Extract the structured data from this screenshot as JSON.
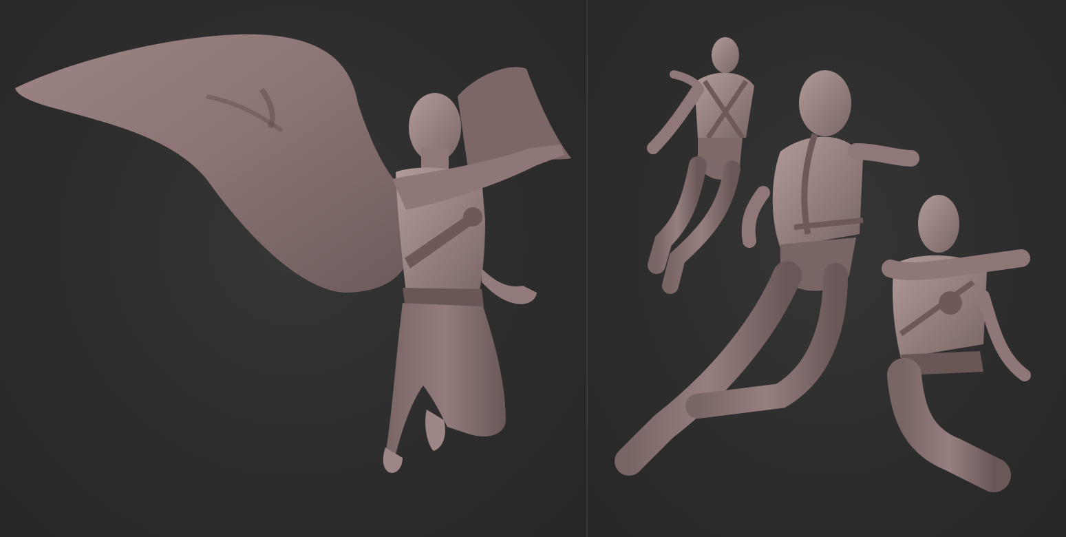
{
  "scene": {
    "description_hidden": false,
    "colors": {
      "background": "#2b2b2b",
      "divider": "#3a3a3a",
      "clay_light": "#a8918f",
      "clay_mid": "#87706f",
      "clay_dark": "#5e4c4c",
      "strap": "#6e5858"
    },
    "panels": [
      {
        "id": "left",
        "figures": [
          "caped-flying-figure"
        ]
      },
      {
        "id": "right",
        "figures": [
          "back-view-figure",
          "side-view-figure",
          "front-view-figure"
        ]
      }
    ]
  }
}
